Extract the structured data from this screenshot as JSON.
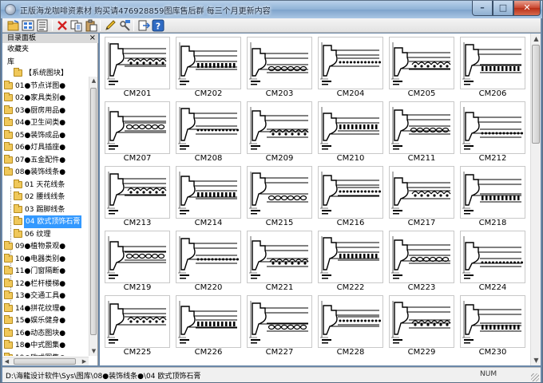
{
  "window": {
    "title": "正版海龙咖啡资素材 购买请476928859图库售后群 每三个月更新内容",
    "min_glyph": "–",
    "max_glyph": "□",
    "close_glyph": "✕"
  },
  "toolbar": {
    "buttons": [
      {
        "icon": "open-folder-icon"
      },
      {
        "icon": "image-view-icon"
      },
      {
        "icon": "details-view-icon"
      },
      {
        "icon": "delete-icon"
      },
      {
        "icon": "copy-icon"
      },
      {
        "icon": "paste-icon"
      },
      {
        "icon": "edit-pen-icon"
      },
      {
        "icon": "properties-icon"
      },
      {
        "icon": "export-icon"
      },
      {
        "icon": "help-icon"
      }
    ]
  },
  "left_panel": {
    "catalog_label": "目录面板",
    "close_glyph": "×",
    "favorites_label": "收藏夹",
    "library_label": "库",
    "tree": [
      {
        "label": "【系统图块】",
        "level": 1
      },
      {
        "label": "01●节点详图●",
        "level": 0
      },
      {
        "label": "02●家具类别●",
        "level": 0
      },
      {
        "label": "03●厨房用品●",
        "level": 0
      },
      {
        "label": "04●卫生间类●",
        "level": 0
      },
      {
        "label": "05●装饰成品●",
        "level": 0
      },
      {
        "label": "06●灯具插座●",
        "level": 0
      },
      {
        "label": "07●五金配件●",
        "level": 0
      },
      {
        "label": "08●装饰线条●",
        "level": 0
      },
      {
        "label": "01 天花线条",
        "level": 1
      },
      {
        "label": "02 腰线线条",
        "level": 1
      },
      {
        "label": "03 踢脚线条",
        "level": 1
      },
      {
        "label": "04 欧式顶饰石膏",
        "level": 1,
        "selected": true
      },
      {
        "label": "06 纹理",
        "level": 1
      },
      {
        "label": "09●植物景观●",
        "level": 0
      },
      {
        "label": "10●电器类别●",
        "level": 0
      },
      {
        "label": "11●门窗隔断●",
        "level": 0
      },
      {
        "label": "12●栏杆楼梯●",
        "level": 0
      },
      {
        "label": "13●交通工具●",
        "level": 0
      },
      {
        "label": "14●拼花纹理●",
        "level": 0
      },
      {
        "label": "15●娱乐健身●",
        "level": 0
      },
      {
        "label": "16●动态图块●",
        "level": 0
      },
      {
        "label": "18●中式图集●",
        "level": 0
      },
      {
        "label": "19●欧式图集●",
        "level": 0
      }
    ]
  },
  "thumbnails": [
    "CM201",
    "CM202",
    "CM203",
    "CM204",
    "CM205",
    "CM206",
    "CM207",
    "CM208",
    "CM209",
    "CM210",
    "CM211",
    "CM212",
    "CM213",
    "CM214",
    "CM215",
    "CM216",
    "CM217",
    "CM218",
    "CM219",
    "CM220",
    "CM221",
    "CM222",
    "CM223",
    "CM224",
    "CM225",
    "CM226",
    "CM227",
    "CM228",
    "CM229",
    "CM230"
  ],
  "status": {
    "path": "D:\\海龍设计软件\\Sys\\图库\\08●装饰线条●\\04 欧式顶饰石膏",
    "num": "NUM"
  }
}
